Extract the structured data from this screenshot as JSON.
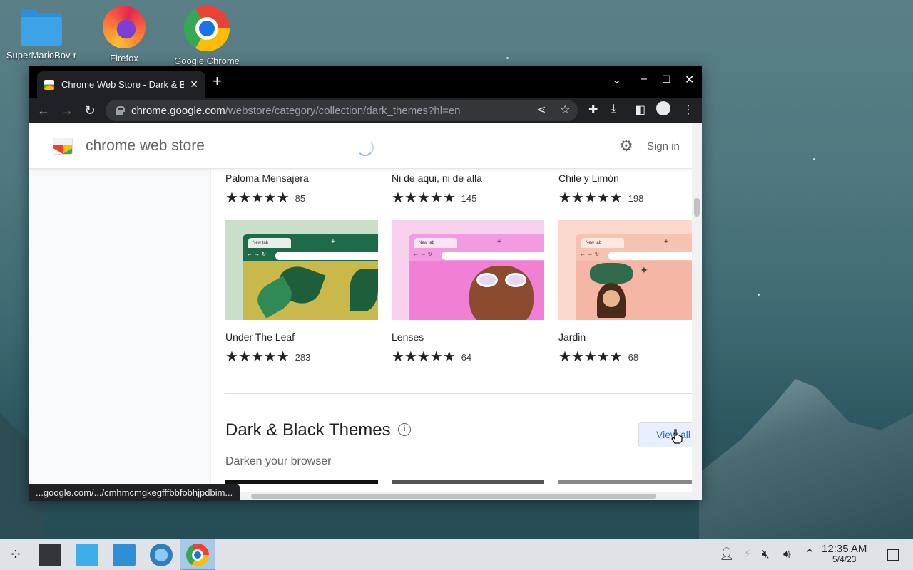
{
  "desktop": {
    "icons": [
      {
        "label": "SuperMarioBov-r"
      },
      {
        "label": "Firefox"
      },
      {
        "label": "Google Chrome"
      }
    ]
  },
  "browser": {
    "tab_title": "Chrome Web Store - Dark & B",
    "tab_close": "✕",
    "new_tab": "+",
    "url_host": "chrome.google.com",
    "url_path": "/webstore/category/collection/dark_themes?hl=en",
    "status_url": "...google.com/.../cmhmcmgkegfffbbfobhjpdbim..."
  },
  "store": {
    "name": "chrome web store",
    "sign_in": "Sign in",
    "themes_row1": [
      {
        "name": "Paloma Mensajera",
        "stars": "★★★★★",
        "count": "85"
      },
      {
        "name": "Ni de aqui, ni de alla",
        "stars": "★★★★★",
        "count": "145"
      },
      {
        "name": "Chile y Limón",
        "stars": "★★★★★",
        "count": "198"
      }
    ],
    "themes_row2": [
      {
        "name": "Under The Leaf",
        "stars": "★★★★★",
        "count": "283",
        "thumb_tab": "New tab"
      },
      {
        "name": "Lenses",
        "stars": "★★★★★",
        "count": "64",
        "thumb_tab": "New tab"
      },
      {
        "name": "Jardin",
        "stars": "★★★★★",
        "count": "68",
        "thumb_tab": "New tab"
      }
    ],
    "section": {
      "title": "Dark & Black Themes",
      "subtitle": "Darken your browser",
      "view_all": "View all"
    }
  },
  "taskbar": {
    "time": "12:35 AM",
    "date": "5/4/23"
  },
  "colors": {
    "leaf_bg": "#c9b94a",
    "leaf_chrome": "#1e6b4a",
    "lenses_bg": "#f27fd6",
    "jardin_bg": "#f6b6a6"
  }
}
